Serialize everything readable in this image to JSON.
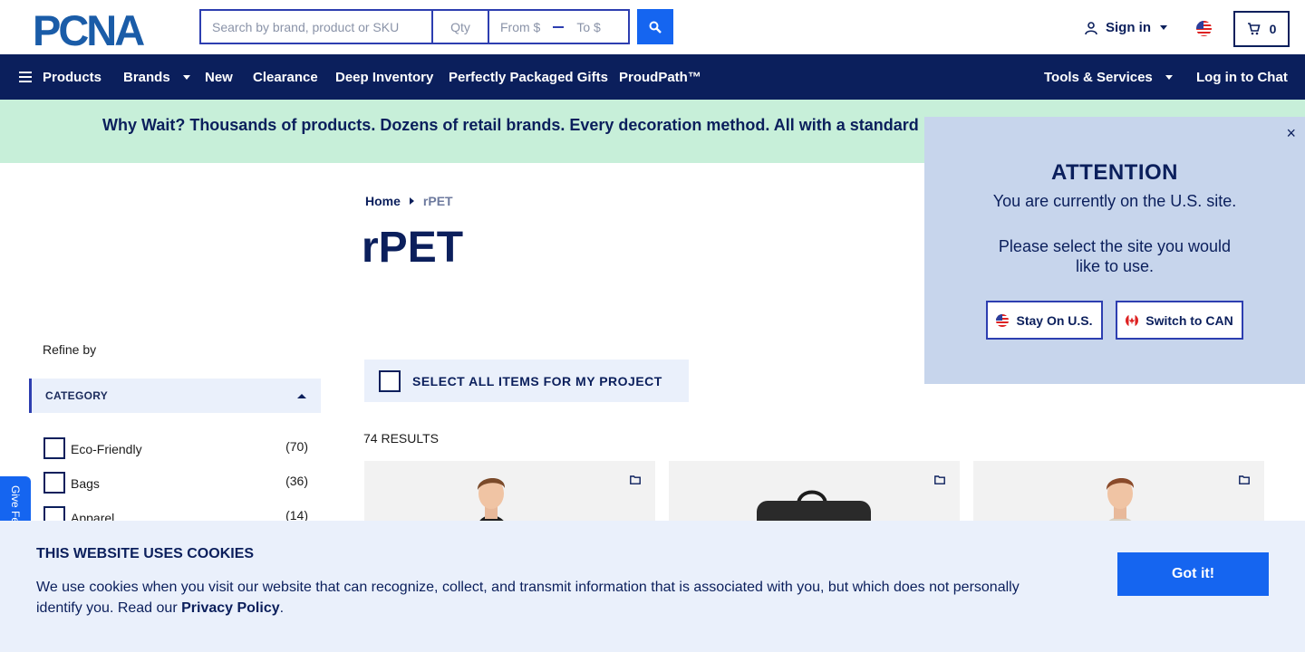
{
  "header": {
    "logo_text": "PCNA",
    "search_placeholder": "Search by brand, product or SKU",
    "qty_placeholder": "Qty",
    "price_from_placeholder": "From $",
    "price_to_placeholder": "To $",
    "signin_label": "Sign in",
    "cart_count": "0",
    "icons": {
      "search": "search-icon",
      "user": "user-icon",
      "cart": "cart-icon",
      "flag": "us-flag-icon"
    }
  },
  "nav": {
    "products": "Products",
    "brands": "Brands",
    "new": "New",
    "clearance": "Clearance",
    "deep_inventory": "Deep Inventory",
    "gifts": "Perfectly Packaged Gifts",
    "proudpath": "ProudPath™",
    "tools": "Tools & Services",
    "chat": "Log in to Chat"
  },
  "promo": {
    "text": "Why Wait? Thousands of products. Dozens of retail brands. Every decoration method. All with a standard"
  },
  "breadcrumb": {
    "home": "Home",
    "current": "rPET"
  },
  "page_title": "rPET",
  "sidebar": {
    "refine_label": "Refine by",
    "category_header": "CATEGORY",
    "facets": [
      {
        "label": "Eco-Friendly",
        "count": "(70)"
      },
      {
        "label": "Bags",
        "count": "(36)"
      },
      {
        "label": "Apparel",
        "count": "(14)"
      }
    ]
  },
  "main": {
    "select_all_label": "SELECT ALL ITEMS FOR MY PROJECT",
    "results_label": "74 RESULTS"
  },
  "attention": {
    "close": "×",
    "title": "ATTENTION",
    "message1": "You are currently on the U.S. site.",
    "message2": "Please select the site you would like to use.",
    "stay_label": "Stay On U.S.",
    "switch_label": "Switch to CAN"
  },
  "feedback_label": "Give Feedback",
  "cookie": {
    "title": "THIS WEBSITE USES COOKIES",
    "text": "We use cookies when you visit our website that can recognize, collect, and transmit information that is associated with you, but which does not personally identify you. Read our ",
    "policy_link": "Privacy Policy",
    "period": ".",
    "button": "Got it!"
  },
  "colors": {
    "navy": "#0b1f5c",
    "accent_blue": "#1565f0",
    "promo_green": "#c7efd9",
    "modal_bg": "#c7d5ec",
    "light_panel": "#eaf0fb"
  }
}
